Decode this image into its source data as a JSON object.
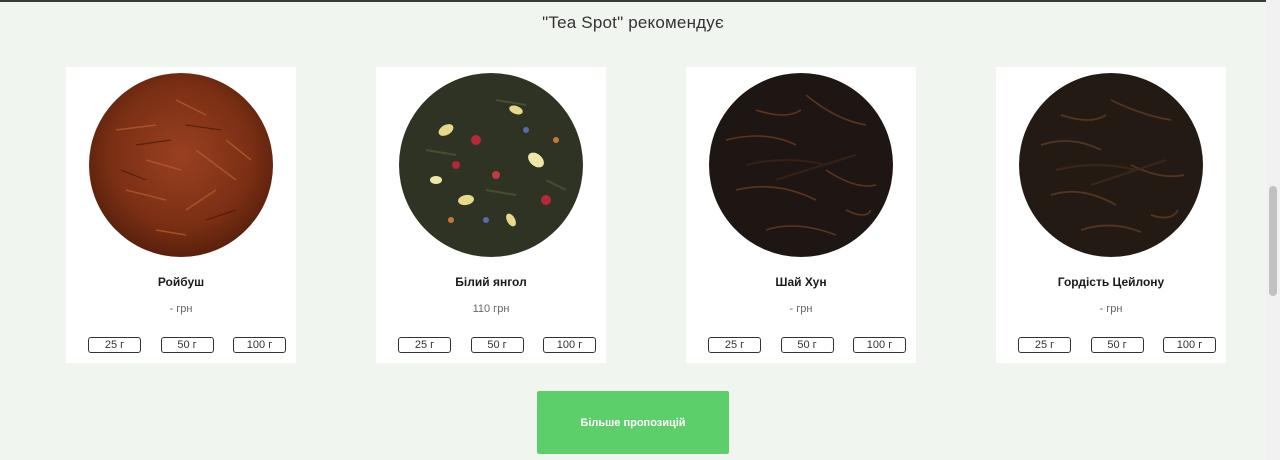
{
  "section": {
    "title": "\"Tea Spot\" рекомендує"
  },
  "products": [
    {
      "name": "Ройбуш",
      "price": "- грн",
      "weights": [
        "25 г",
        "50 г",
        "100 г"
      ],
      "image": "rooibos-tea-image",
      "color": "#7a2f14"
    },
    {
      "name": "Білий янгол",
      "price": "110 грн",
      "weights": [
        "25 г",
        "50 г",
        "100 г"
      ],
      "image": "flower-tea-blend-image",
      "color": "#2f3324"
    },
    {
      "name": "Шай Хун",
      "price": "- грн",
      "weights": [
        "25 г",
        "50 г",
        "100 г"
      ],
      "image": "black-tea-image",
      "color": "#1e1612"
    },
    {
      "name": "Гордість Цейлону",
      "price": "- грн",
      "weights": [
        "25 г",
        "50 г",
        "100 г"
      ],
      "image": "ceylon-tea-image",
      "color": "#241a14"
    }
  ],
  "more_button": {
    "label": "Більше пропозицій",
    "color": "#5ccf6a"
  }
}
